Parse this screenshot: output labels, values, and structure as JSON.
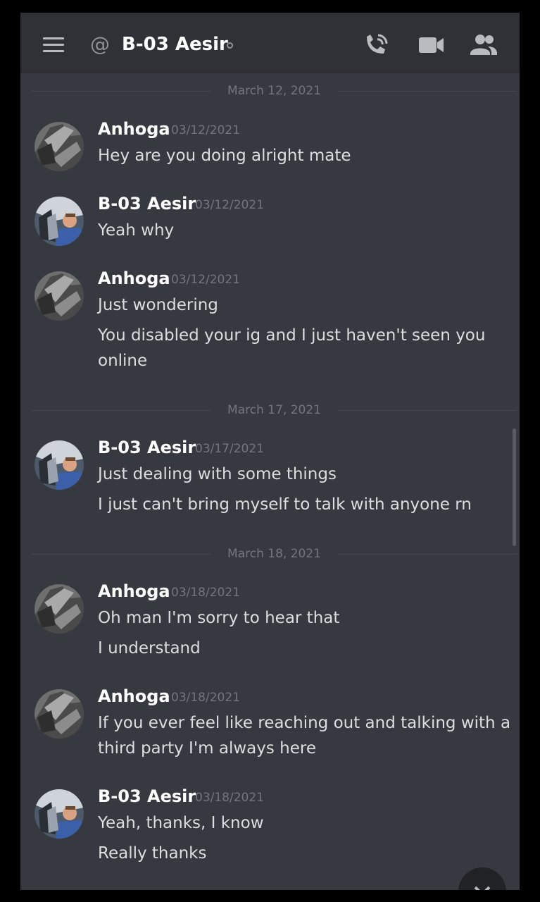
{
  "header": {
    "channel_prefix": "@",
    "channel_name": "B-03 Aesir"
  },
  "icons": {
    "menu": "hamburger-menu-icon",
    "call": "phone-call-icon",
    "video": "video-camera-icon",
    "members": "members-icon",
    "jump": "jump-to-present-icon"
  },
  "dividers": [
    "March 12, 2021",
    "March 17, 2021",
    "March 18, 2021"
  ],
  "messages": [
    {
      "author": "Anhoga",
      "timestamp": "03/12/2021",
      "lines": [
        "Hey are you doing alright mate"
      ]
    },
    {
      "author": "B-03 Aesir",
      "timestamp": "03/12/2021",
      "lines": [
        "Yeah why"
      ]
    },
    {
      "author": "Anhoga",
      "timestamp": "03/12/2021",
      "lines": [
        "Just wondering",
        "You disabled your ig and I just haven't seen you",
        "online"
      ]
    },
    {
      "author": "B-03 Aesir",
      "timestamp": "03/17/2021",
      "lines": [
        "Just dealing with some things",
        "I just can't bring myself to talk with anyone rn"
      ]
    },
    {
      "author": "Anhoga",
      "timestamp": "03/18/2021",
      "lines": [
        "Oh man I'm sorry to hear that",
        "I understand"
      ]
    },
    {
      "author": "Anhoga",
      "timestamp": "03/18/2021",
      "lines": [
        "If you ever feel like reaching out and talking with a",
        "third party I'm always here"
      ]
    },
    {
      "author": "B-03 Aesir",
      "timestamp": "03/18/2021",
      "lines": [
        "Yeah, thanks, I know",
        "Really thanks"
      ]
    }
  ],
  "colors": {
    "background": "#36393f",
    "header": "#2f3136",
    "username": "#ffffff",
    "timestamp": "#72767d",
    "message_text": "#dcddde"
  }
}
